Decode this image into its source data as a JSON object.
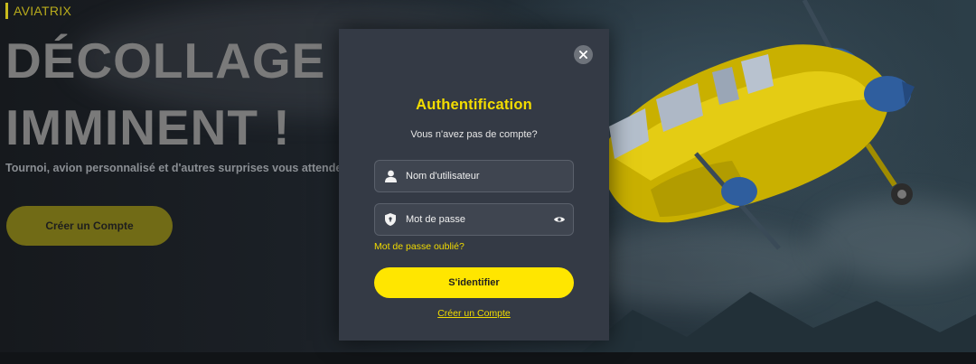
{
  "hero": {
    "brand": "AVIATRIX",
    "title": "DÉCOLLAGE IMMINENT !",
    "subtitle": "Tournoi, avion personnalisé et d'autres surprises vous attendent",
    "cta_label": "Créer un Compte"
  },
  "modal": {
    "title": "Authentification",
    "subtitle": "Vous n'avez pas de compte?",
    "username_placeholder": "Nom d'utilisateur",
    "password_placeholder": "Mot de passe",
    "forgot_label": "Mot de passe oublié?",
    "login_label": "S'identifier",
    "signup_label": "Créer un Compte"
  },
  "icons": {
    "close": "close-icon",
    "user": "user-icon",
    "shield": "shield-icon",
    "eye": "eye-icon"
  },
  "colors": {
    "accent": "#ffe600",
    "modal_bg": "#343a45",
    "field_bg": "#3f4550"
  }
}
